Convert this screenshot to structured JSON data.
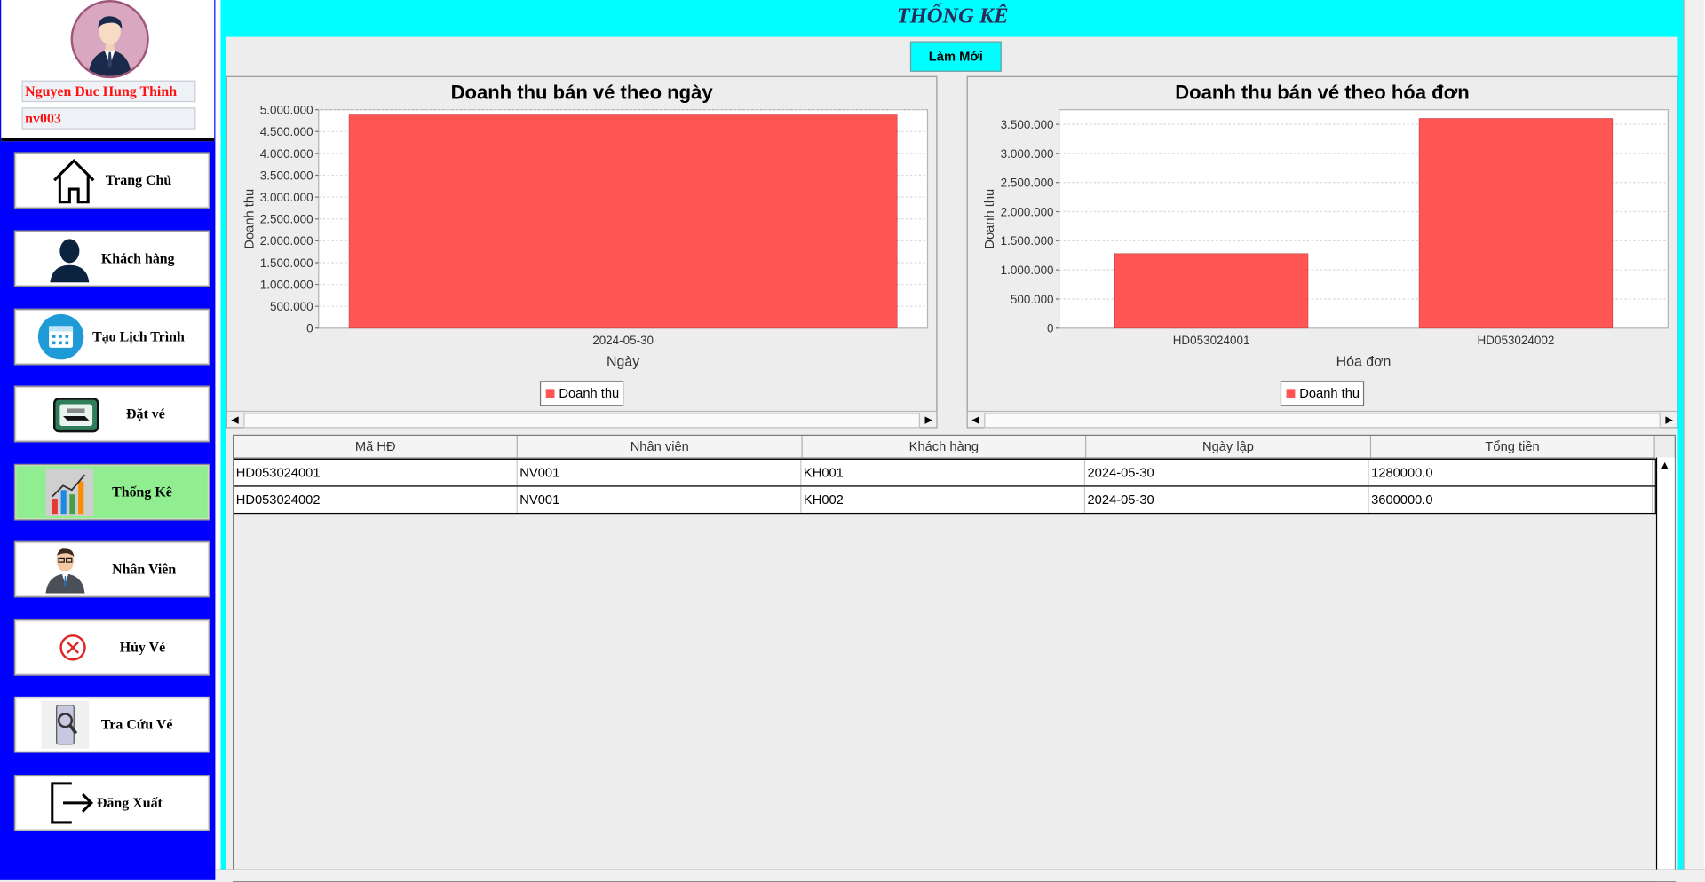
{
  "window": {
    "title": "THỐNG KÊ"
  },
  "user": {
    "name": "Nguyen Duc Hung Thinh",
    "id": "nv003"
  },
  "nav": [
    {
      "label": "Trang Chủ",
      "icon": "house-icon",
      "active": false
    },
    {
      "label": "Khách hàng",
      "icon": "person-icon",
      "active": false
    },
    {
      "label": "Tạo Lịch Trình",
      "icon": "calendar-icon",
      "active": false
    },
    {
      "label": "Đặt vé",
      "icon": "ticket-machine-icon",
      "active": false
    },
    {
      "label": "Thống Kê",
      "icon": "bar-chart-icon",
      "active": true
    },
    {
      "label": "Nhân Viên",
      "icon": "employee-icon",
      "active": false
    },
    {
      "label": "Hủy Vé",
      "icon": "cancel-icon",
      "active": false
    },
    {
      "label": "Tra Cứu Vé",
      "icon": "search-ticket-icon",
      "active": false
    },
    {
      "label": "Đăng Xuất",
      "icon": "logout-icon",
      "active": false
    }
  ],
  "toolbar": {
    "refresh_label": "Làm Mới"
  },
  "colors": {
    "accent": "#00ffff",
    "sidebar": "#0000ff",
    "bar": "#ff5555",
    "active_nav": "#90ee90",
    "user_text": "#ff1010"
  },
  "chart_data": [
    {
      "type": "bar",
      "title": "Doanh thu bán vé theo ngày",
      "xlabel": "Ngày",
      "ylabel": "Doanh thu",
      "categories": [
        "2024-05-30"
      ],
      "series": [
        {
          "name": "Doanh thu",
          "values": [
            4880000
          ]
        }
      ],
      "ylim": [
        0,
        5000000
      ],
      "yticks": [
        "0",
        "500.000",
        "1.000.000",
        "1.500.000",
        "2.000.000",
        "2.500.000",
        "3.000.000",
        "3.500.000",
        "4.000.000",
        "4.500.000",
        "5.000.000"
      ],
      "grid": true,
      "legend": "bottom-center"
    },
    {
      "type": "bar",
      "title": "Doanh thu bán vé theo hóa đơn",
      "xlabel": "Hóa đơn",
      "ylabel": "Doanh thu",
      "categories": [
        "HD053024001",
        "HD053024002"
      ],
      "series": [
        {
          "name": "Doanh thu",
          "values": [
            1280000,
            3600000
          ]
        }
      ],
      "ylim": [
        0,
        3750000
      ],
      "yticks": [
        "0",
        "500.000",
        "1.000.000",
        "1.500.000",
        "2.000.000",
        "2.500.000",
        "3.000.000",
        "3.500.000"
      ],
      "grid": true,
      "legend": "bottom-center"
    }
  ],
  "table": {
    "columns": [
      "Mã HĐ",
      "Nhân viên",
      "Khách hàng",
      "Ngày lập",
      "Tổng tiền"
    ],
    "rows": [
      [
        "HD053024001",
        "NV001",
        "KH001",
        "2024-05-30",
        "1280000.0"
      ],
      [
        "HD053024002",
        "NV001",
        "KH002",
        "2024-05-30",
        "3600000.0"
      ]
    ]
  }
}
